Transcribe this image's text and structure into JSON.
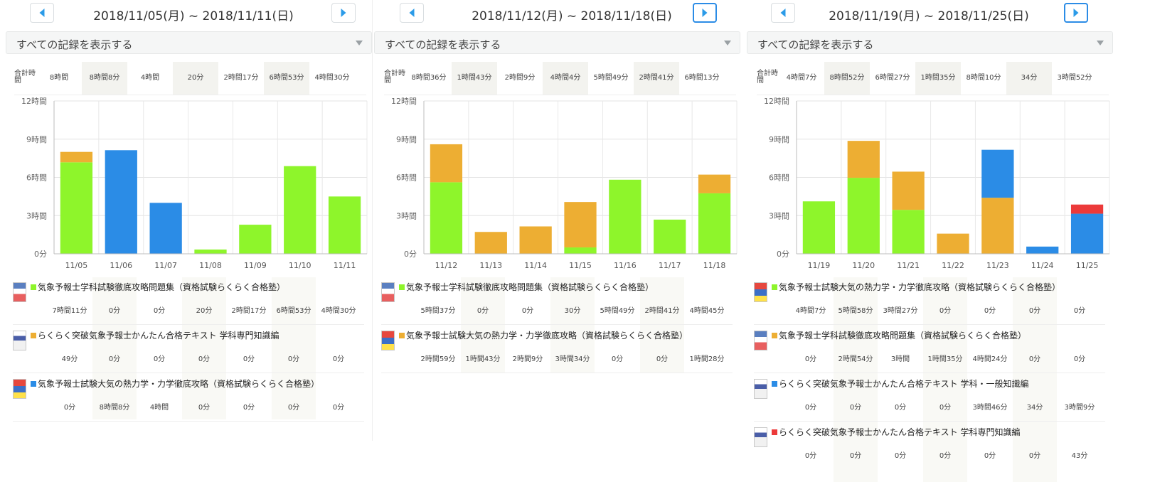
{
  "colors": {
    "green": "#8ef52b",
    "blue": "#2b8ce6",
    "orange": "#edae33",
    "red": "#ec3a3a",
    "nav_arrow": "#2b9be8"
  },
  "icons": {
    "prev": "chevron-left-icon",
    "next": "chevron-right-icon",
    "dropdown": "caret-down-icon"
  },
  "total_label": "合計時間",
  "y_ticks": [
    "12時間",
    "9時間",
    "6時間",
    "3時間",
    "0分"
  ],
  "weeks": [
    {
      "range": "2018/11/05(月) ~ 2018/11/11(日)",
      "filter": "すべての記録を表示する",
      "next_active": false,
      "totals": [
        "8時間",
        "8時間8分",
        "4時間",
        "20分",
        "2時間17分",
        "6時間53分",
        "4時間30分"
      ],
      "days": [
        "11/05",
        "11/06",
        "11/07",
        "11/08",
        "11/09",
        "11/10",
        "11/11"
      ],
      "books": [
        {
          "title": "気象予報士学科試験徹底攻略問題集（資格試験らくらく合格塾）",
          "color": "green",
          "times": [
            "7時間11分",
            "0分",
            "0分",
            "20分",
            "2時間17分",
            "6時間53分",
            "4時間30分"
          ]
        },
        {
          "title": "らくらく突破気象予報士かんたん合格テキスト 学科専門知識編",
          "color": "orange",
          "times": [
            "49分",
            "0分",
            "0分",
            "0分",
            "0分",
            "0分",
            "0分"
          ]
        },
        {
          "title": "気象予報士試験大気の熱力学・力学徹底攻略（資格試験らくらく合格塾）",
          "color": "blue",
          "times": [
            "0分",
            "8時間8分",
            "4時間",
            "0分",
            "0分",
            "0分",
            "0分"
          ]
        }
      ]
    },
    {
      "range": "2018/11/12(月) ~ 2018/11/18(日)",
      "filter": "すべての記録を表示する",
      "next_active": true,
      "totals": [
        "8時間36分",
        "1時間43分",
        "2時間9分",
        "4時間4分",
        "5時間49分",
        "2時間41分",
        "6時間13分"
      ],
      "days": [
        "11/12",
        "11/13",
        "11/14",
        "11/15",
        "11/16",
        "11/17",
        "11/18"
      ],
      "books": [
        {
          "title": "気象予報士学科試験徹底攻略問題集（資格試験らくらく合格塾）",
          "color": "green",
          "times": [
            "5時間37分",
            "0分",
            "0分",
            "30分",
            "5時間49分",
            "2時間41分",
            "4時間45分"
          ]
        },
        {
          "title": "気象予報士試験大気の熱力学・力学徹底攻略（資格試験らくらく合格塾）",
          "color": "orange",
          "times": [
            "2時間59分",
            "1時間43分",
            "2時間9分",
            "3時間34分",
            "0分",
            "0分",
            "1時間28分"
          ]
        }
      ]
    },
    {
      "range": "2018/11/19(月) ~ 2018/11/25(日)",
      "filter": "すべての記録を表示する",
      "next_active": true,
      "totals": [
        "4時間7分",
        "8時間52分",
        "6時間27分",
        "1時間35分",
        "8時間10分",
        "34分",
        "3時間52分"
      ],
      "days": [
        "11/19",
        "11/20",
        "11/21",
        "11/22",
        "11/23",
        "11/24",
        "11/25"
      ],
      "books": [
        {
          "title": "気象予報士試験大気の熱力学・力学徹底攻略（資格試験らくらく合格塾）",
          "color": "green",
          "times": [
            "4時間7分",
            "5時間58分",
            "3時間27分",
            "0分",
            "0分",
            "0分",
            "0分"
          ]
        },
        {
          "title": "気象予報士学科試験徹底攻略問題集（資格試験らくらく合格塾）",
          "color": "orange",
          "times": [
            "0分",
            "2時間54分",
            "3時間",
            "1時間35分",
            "4時間24分",
            "0分",
            "0分"
          ]
        },
        {
          "title": "らくらく突破気象予報士かんたん合格テキスト 学科・一般知識編",
          "color": "blue",
          "times": [
            "0分",
            "0分",
            "0分",
            "0分",
            "3時間46分",
            "34分",
            "3時間9分"
          ]
        },
        {
          "title": "らくらく突破気象予報士かんたん合格テキスト 学科専門知識編",
          "color": "red",
          "times": [
            "0分",
            "0分",
            "0分",
            "0分",
            "0分",
            "0分",
            "43分"
          ]
        }
      ]
    }
  ],
  "chart_data": [
    {
      "type": "bar",
      "stacked": true,
      "categories": [
        "11/05",
        "11/06",
        "11/07",
        "11/08",
        "11/09",
        "11/10",
        "11/11"
      ],
      "ylim": [
        0,
        720
      ],
      "y_unit": "minutes",
      "series": [
        {
          "color": "#8ef52b",
          "values": [
            431,
            0,
            0,
            20,
            137,
            413,
            270
          ]
        },
        {
          "color": "#edae33",
          "values": [
            49,
            0,
            0,
            0,
            0,
            0,
            0
          ]
        },
        {
          "color": "#2b8ce6",
          "values": [
            0,
            488,
            240,
            0,
            0,
            0,
            0
          ]
        }
      ]
    },
    {
      "type": "bar",
      "stacked": true,
      "categories": [
        "11/12",
        "11/13",
        "11/14",
        "11/15",
        "11/16",
        "11/17",
        "11/18"
      ],
      "ylim": [
        0,
        720
      ],
      "y_unit": "minutes",
      "series": [
        {
          "color": "#8ef52b",
          "values": [
            337,
            0,
            0,
            30,
            349,
            161,
            285
          ]
        },
        {
          "color": "#edae33",
          "values": [
            179,
            103,
            129,
            214,
            0,
            0,
            88
          ]
        }
      ]
    },
    {
      "type": "bar",
      "stacked": true,
      "categories": [
        "11/19",
        "11/20",
        "11/21",
        "11/22",
        "11/23",
        "11/24",
        "11/25"
      ],
      "ylim": [
        0,
        720
      ],
      "y_unit": "minutes",
      "series": [
        {
          "color": "#8ef52b",
          "values": [
            247,
            358,
            207,
            0,
            0,
            0,
            0
          ]
        },
        {
          "color": "#edae33",
          "values": [
            0,
            174,
            180,
            95,
            264,
            0,
            0
          ]
        },
        {
          "color": "#2b8ce6",
          "values": [
            0,
            0,
            0,
            0,
            226,
            34,
            189
          ]
        },
        {
          "color": "#ec3a3a",
          "values": [
            0,
            0,
            0,
            0,
            0,
            0,
            43
          ]
        }
      ]
    }
  ]
}
